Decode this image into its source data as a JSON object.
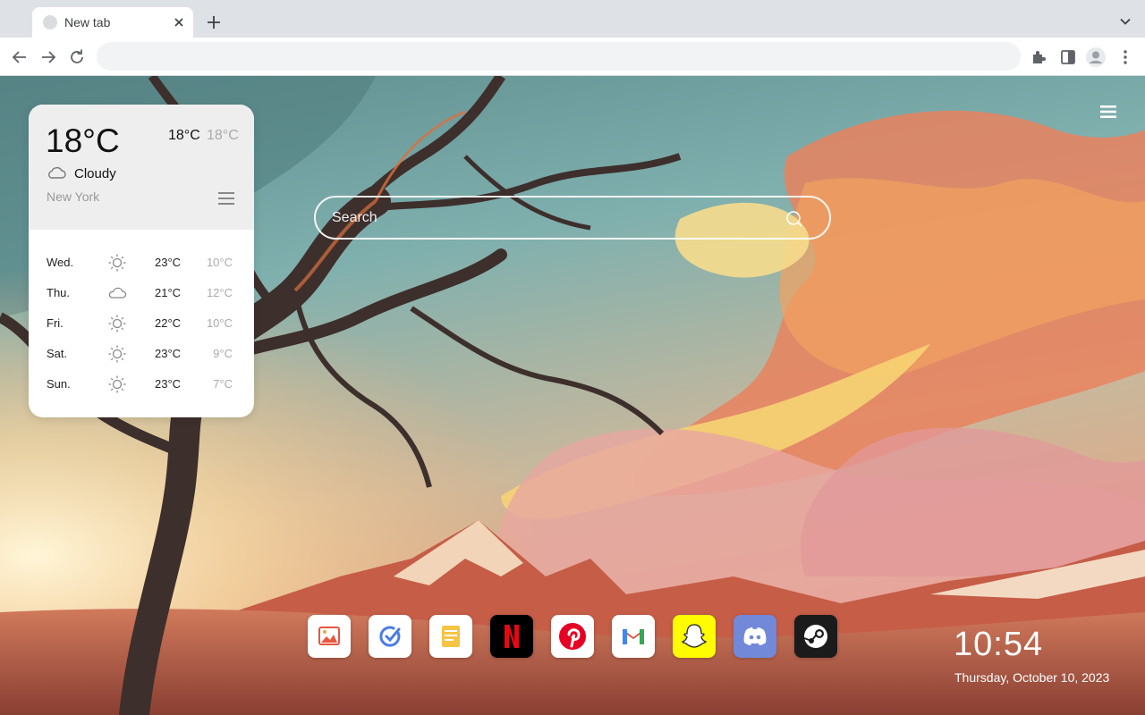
{
  "browser": {
    "tab_title": "New tab",
    "address_value": ""
  },
  "search": {
    "placeholder": "Search"
  },
  "weather": {
    "current_temp": "18°C",
    "today_high": "18°C",
    "today_low": "18°C",
    "condition": "Cloudy",
    "condition_icon": "cloud-icon",
    "city": "New York",
    "forecast": [
      {
        "day": "Wed.",
        "icon": "sun-icon",
        "high": "23°C",
        "low": "10°C"
      },
      {
        "day": "Thu.",
        "icon": "cloud-icon",
        "high": "21°C",
        "low": "12°C"
      },
      {
        "day": "Fri.",
        "icon": "sun-icon",
        "high": "22°C",
        "low": "10°C"
      },
      {
        "day": "Sat.",
        "icon": "sun-icon",
        "high": "23°C",
        "low": "9°C"
      },
      {
        "day": "Sun.",
        "icon": "sun-icon",
        "high": "23°C",
        "low": "7°C"
      }
    ]
  },
  "dock": [
    {
      "name": "photos",
      "icon": "photo-icon",
      "color": "#ffffff"
    },
    {
      "name": "task",
      "icon": "check-icon",
      "color": "#ffffff"
    },
    {
      "name": "notes",
      "icon": "note-icon",
      "color": "#ffffff"
    },
    {
      "name": "netflix",
      "icon": "netflix-icon",
      "color": "#000000"
    },
    {
      "name": "pinterest",
      "icon": "pinterest-icon",
      "color": "#ffffff"
    },
    {
      "name": "gmail",
      "icon": "gmail-icon",
      "color": "#ffffff"
    },
    {
      "name": "snapchat",
      "icon": "snapchat-icon",
      "color": "#fffc00"
    },
    {
      "name": "discord",
      "icon": "discord-icon",
      "color": "#7289da"
    },
    {
      "name": "steam",
      "icon": "steam-icon",
      "color": "#1b1b1b"
    }
  ],
  "clock": {
    "time": "10:54",
    "date": "Thursday, October 10, 2023"
  },
  "colors": {
    "chrome_bg": "#dee1e6",
    "omnibox_bg": "#f1f3f4",
    "card_bg": "#ffffff",
    "card_header_bg": "#eeeeee"
  }
}
